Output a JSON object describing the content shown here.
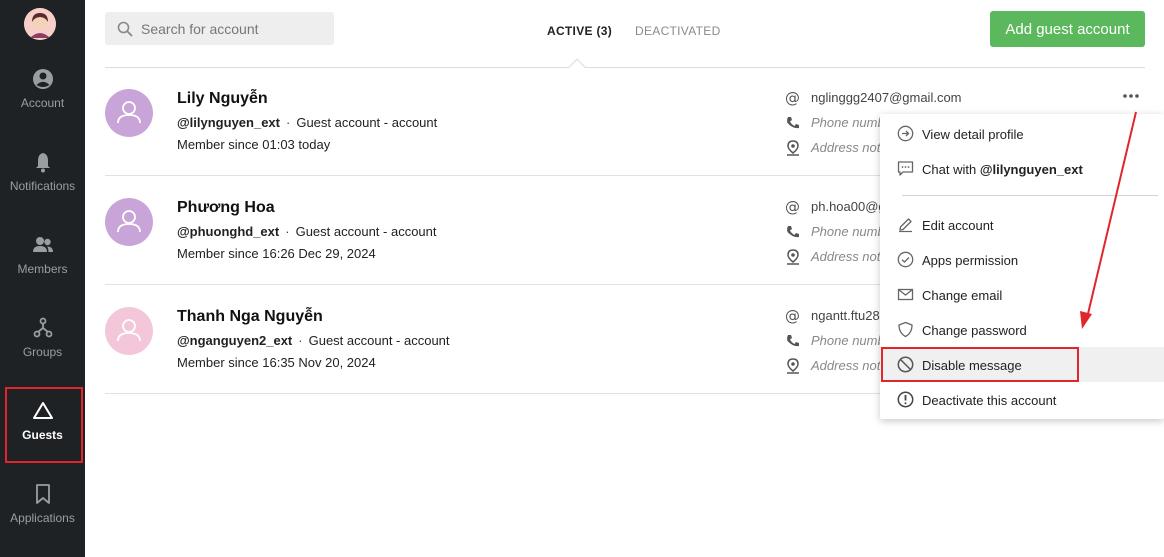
{
  "sidebar": {
    "items": [
      {
        "label": "Account",
        "icon": "user-circle-icon"
      },
      {
        "label": "Notifications",
        "icon": "bell-icon"
      },
      {
        "label": "Members",
        "icon": "members-icon"
      },
      {
        "label": "Groups",
        "icon": "groups-icon"
      },
      {
        "label": "Guests",
        "icon": "triangle-icon"
      },
      {
        "label": "Applications",
        "icon": "bookmark-icon"
      }
    ]
  },
  "search": {
    "placeholder": "Search for account"
  },
  "tabs": {
    "active": "ACTIVE (3)",
    "inactive": "DEACTIVATED"
  },
  "add_button": "Add guest account",
  "accounts": [
    {
      "name": "Lily Nguyễn",
      "handle": "@lilynguyen_ext",
      "type": "Guest account - account",
      "member_since": "Member since 01:03 today",
      "email": "nglinggg2407@gmail.com",
      "phone": "Phone numb",
      "address": "Address not"
    },
    {
      "name": "Phương Hoa",
      "handle": "@phuonghd_ext",
      "type": "Guest account - account",
      "member_since": "Member since 16:26 Dec 29, 2024",
      "email": "ph.hoa00@g",
      "phone": "Phone numb",
      "address": "Address not"
    },
    {
      "name": "Thanh Nga Nguyễn",
      "handle": "@nganguyen2_ext",
      "type": "Guest account - account",
      "member_since": "Member since 16:35 Nov 20, 2024",
      "email": "ngantt.ftu28",
      "phone": "Phone numb",
      "address": "Address not"
    }
  ],
  "menu": {
    "view_profile": "View detail profile",
    "chat_prefix": "Chat with ",
    "chat_handle": "@lilynguyen_ext",
    "edit_account": "Edit account",
    "apps_permission": "Apps permission",
    "change_email": "Change email",
    "change_password": "Change password",
    "disable_message": "Disable message",
    "deactivate": "Deactivate this account"
  },
  "colors": {
    "sidebar_bg": "#1f2225",
    "accent_green": "#5cb85c",
    "highlight_red": "#e0252b",
    "avatar_purple": "#c9a4d8",
    "avatar_pink": "#f4c6da"
  }
}
